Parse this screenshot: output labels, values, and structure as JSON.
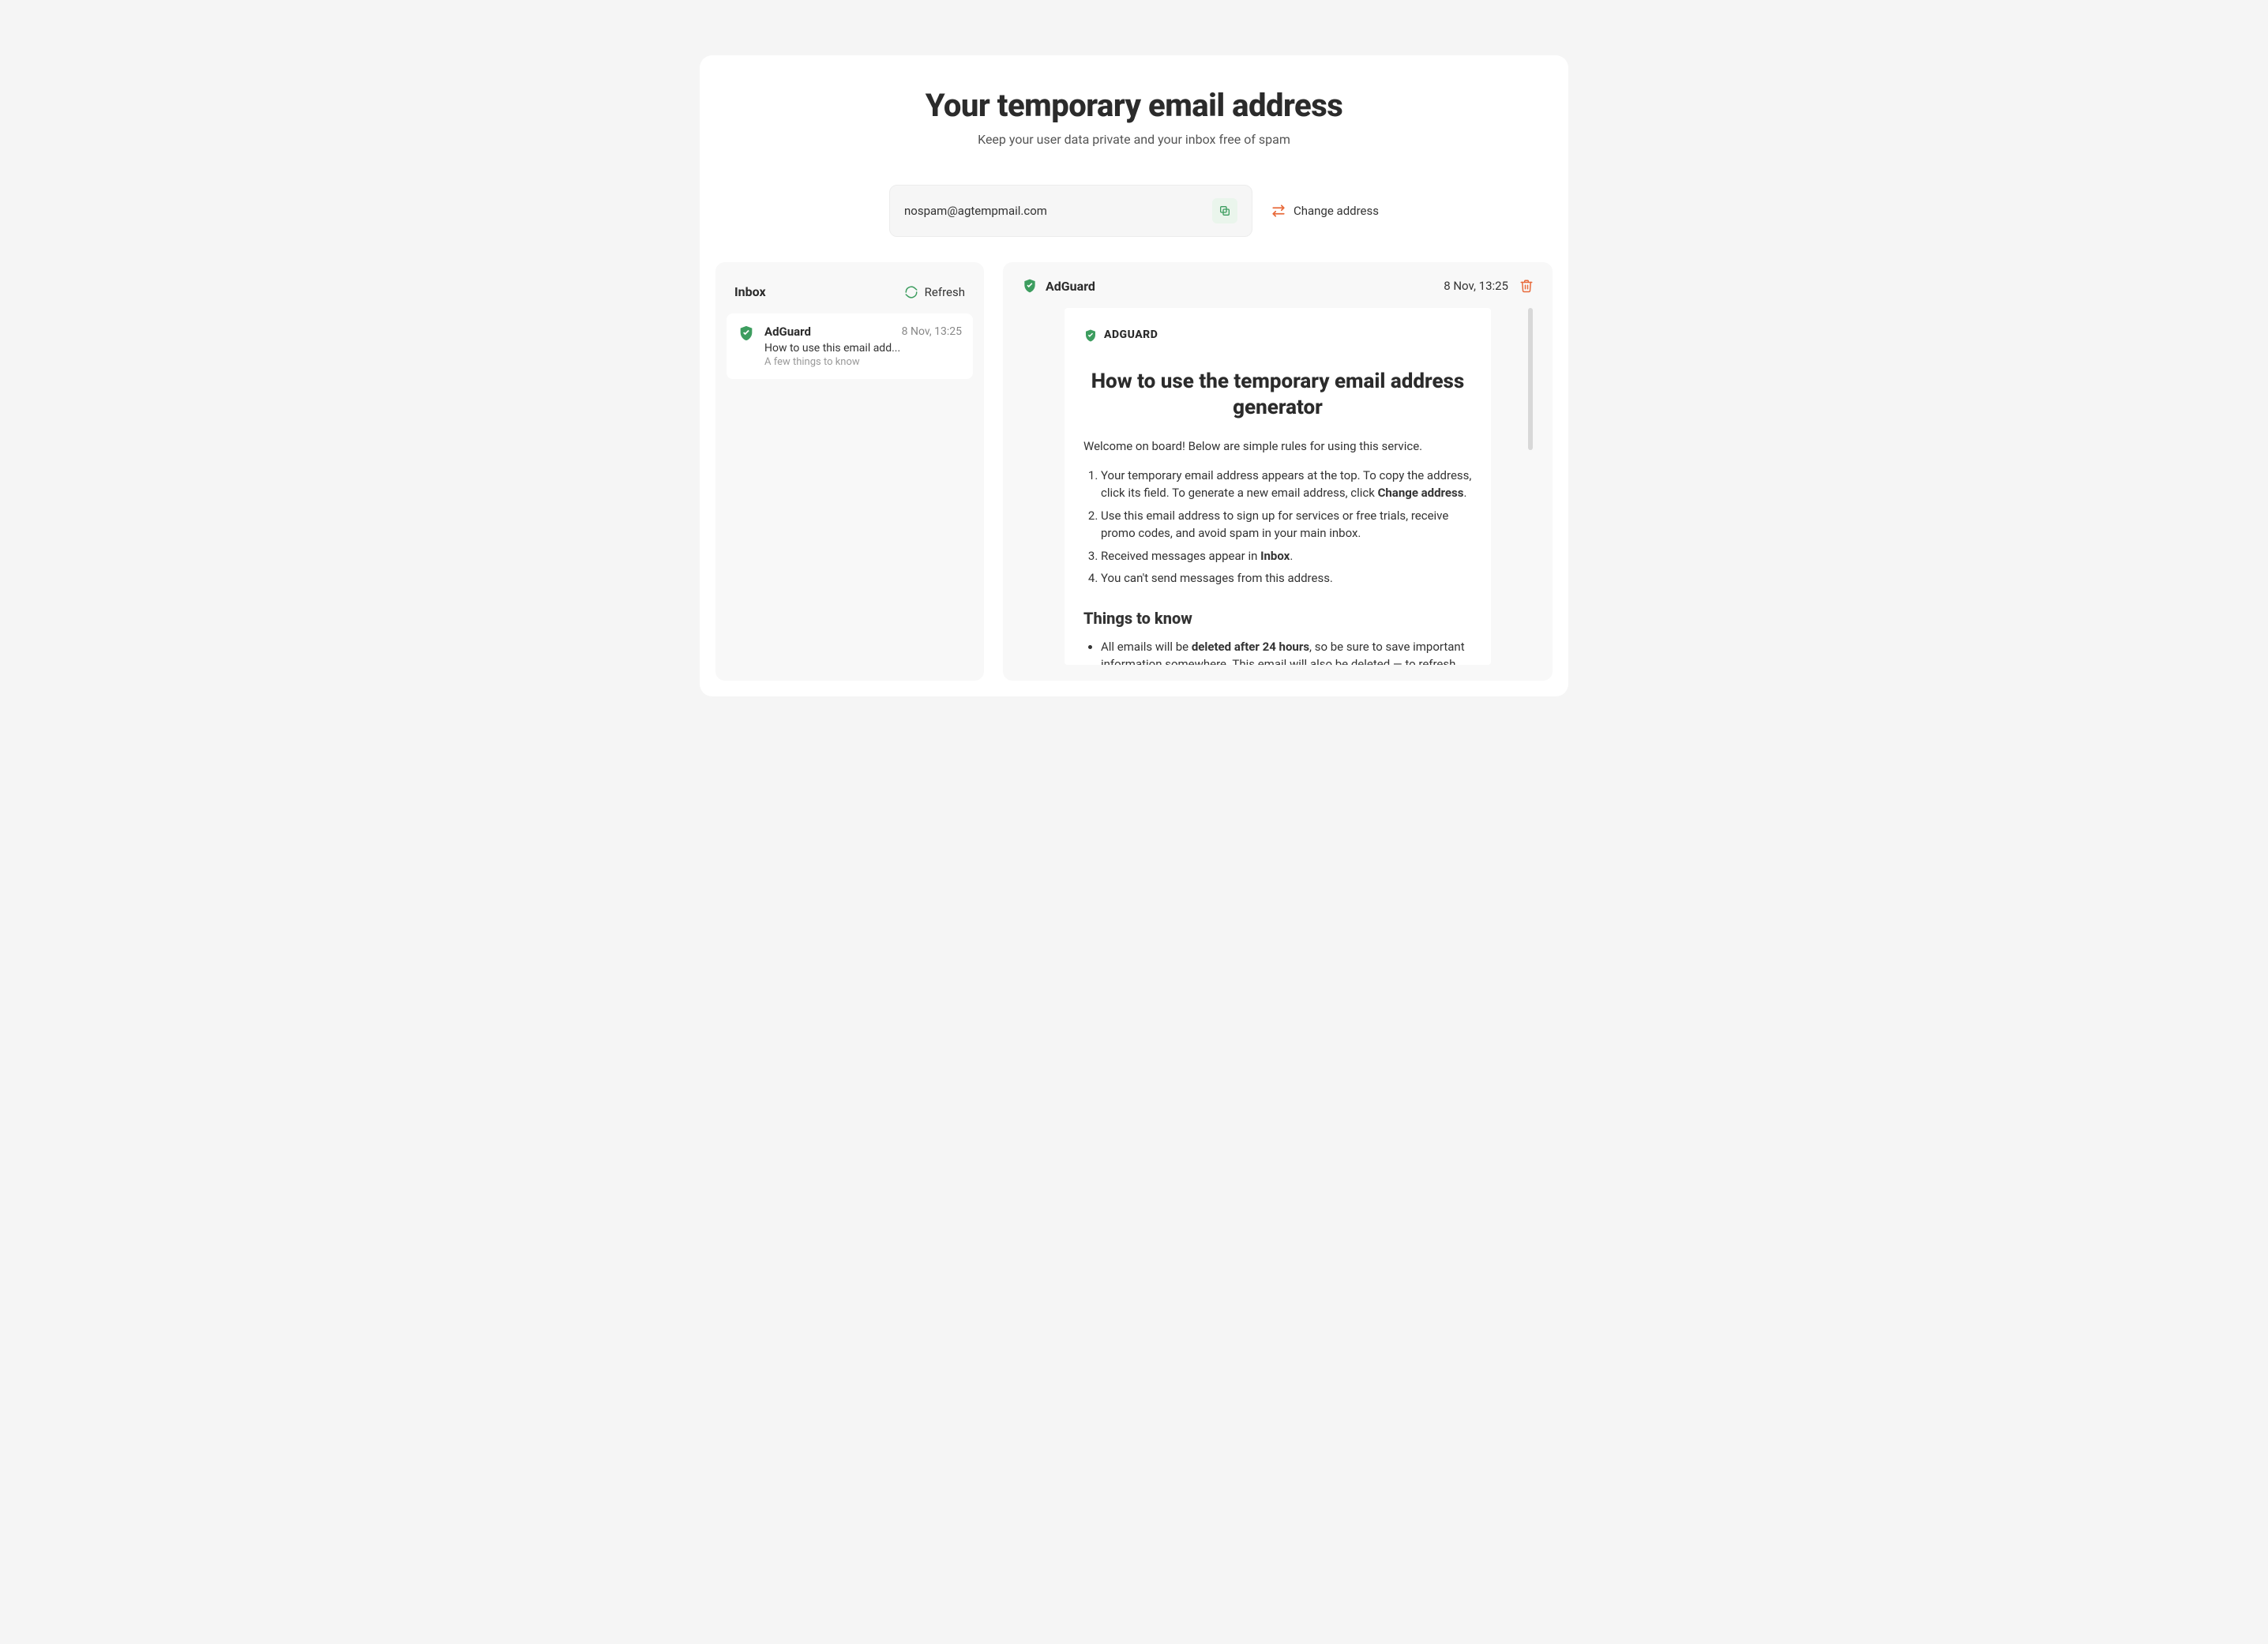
{
  "hero": {
    "title": "Your temporary email address",
    "subtitle": "Keep your user data private and your inbox free of spam"
  },
  "emailField": {
    "address": "nospam@agtempmail.com",
    "copy_label": "Copy",
    "change_label": "Change address"
  },
  "inbox": {
    "title": "Inbox",
    "refresh_label": "Refresh",
    "items": [
      {
        "from": "AdGuard",
        "date": "8 Nov, 13:25",
        "subject": "How to use this email add...",
        "preview": "A few things to know"
      }
    ]
  },
  "reader": {
    "from": "AdGuard",
    "date": "8 Nov, 13:25",
    "brand": "ADGUARD",
    "heading": "How to use the temporary email address generator",
    "intro": "Welcome on board! Below are simple rules for using this service.",
    "step1_a": "Your temporary email address appears at the top. To copy the address, click its field. To generate a new email address, click ",
    "step1_bold": "Change address",
    "step1_b": ".",
    "step2": "Use this email address to sign up for services or free trials, receive promo codes, and avoid spam in your main inbox.",
    "step3_a": "Received messages appear in ",
    "step3_bold": "Inbox",
    "step3_b": ".",
    "step4": "You can't send messages from this address.",
    "section2_title": "Things to know",
    "bullet1_a": "All emails will be ",
    "bullet1_bold": "deleted after 24 hours",
    "bullet1_b": ", so be sure to save important information somewhere. This email will also be deleted — to refresh"
  },
  "colors": {
    "green": "#3d9d5f",
    "orange": "#e86a3a"
  }
}
